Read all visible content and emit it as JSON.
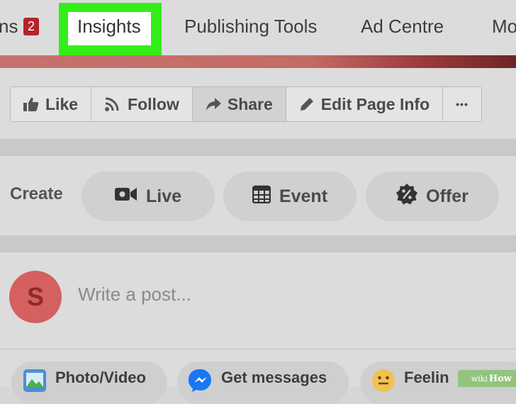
{
  "tabs": {
    "partial_label": "ns",
    "notification_count": "2",
    "insights": "Insights",
    "publishing_tools": "Publishing Tools",
    "ad_centre": "Ad Centre",
    "more_partial": "Mo"
  },
  "actions": {
    "like": "Like",
    "follow": "Follow",
    "share": "Share",
    "edit_page_info": "Edit Page Info",
    "more": "•••"
  },
  "create": {
    "label": "Create",
    "live": "Live",
    "event": "Event",
    "offer": "Offer"
  },
  "post": {
    "avatar_initial": "S",
    "placeholder": "Write a post..."
  },
  "post_options": {
    "photo_video": "Photo/Video",
    "get_messages": "Get messages",
    "feeling": "Feelin"
  },
  "watermark": {
    "prefix": "wiki",
    "brand": "How"
  },
  "colors": {
    "highlight": "#33ee1a",
    "badge": "#b4242b",
    "avatar": "#d4605f",
    "messenger": "#1877f2"
  }
}
